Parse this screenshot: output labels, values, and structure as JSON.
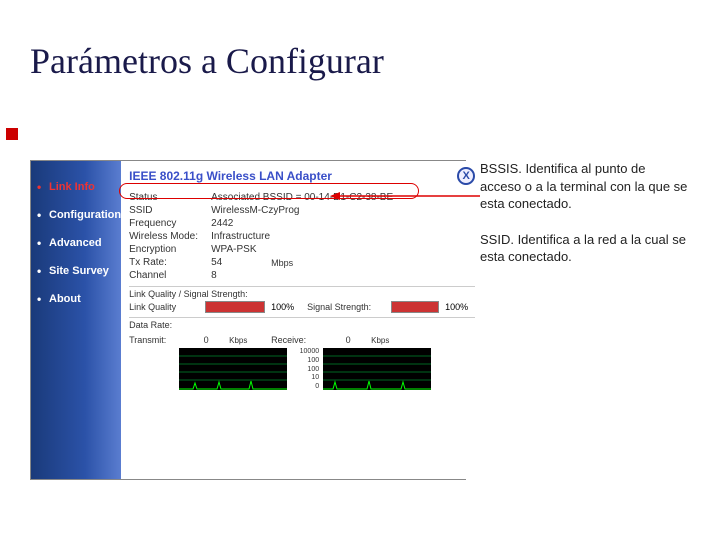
{
  "slide": {
    "title": "Parámetros a Configurar"
  },
  "sidebar": {
    "items": [
      {
        "label": "Link Info"
      },
      {
        "label": "Configuration"
      },
      {
        "label": "Advanced"
      },
      {
        "label": "Site Survey"
      },
      {
        "label": "About"
      }
    ]
  },
  "panel": {
    "title": "IEEE 802.11g Wireless LAN Adapter",
    "rows": {
      "status_lbl": "Status",
      "status_val": "Associated BSSID = 00-14-D1-C2-38-BE",
      "ssid_lbl": "SSID",
      "ssid_val": "WirelessM-CzyProg",
      "freq_lbl": "Frequency",
      "freq_val": "2442",
      "mode_lbl": "Wireless Mode:",
      "mode_val": "Infrastructure",
      "enc_lbl": "Encryption",
      "enc_val": "WPA-PSK",
      "txrate_lbl": "Tx Rate:",
      "txrate_val": "54",
      "txrate_unit": "Mbps",
      "channel_lbl": "Channel",
      "channel_val": "8"
    },
    "quality_section": "Link Quality / Signal Strength:",
    "link_quality_lbl": "Link Quality",
    "link_quality_pct": "100%",
    "signal_lbl": "Signal Strength:",
    "signal_pct": "100%",
    "data_rate_section": "Data Rate:",
    "transmit_lbl": "Transmit:",
    "transmit_val": "0",
    "transmit_unit": "Kbps",
    "receive_lbl": "Receive:",
    "receive_val": "0",
    "receive_unit": "Kbps",
    "yscale": [
      "10000",
      "100",
      "100",
      "10",
      "0"
    ]
  },
  "annotations": {
    "bssis": "BSSIS. Identifica al punto de acceso o a la terminal con la que se esta conectado.",
    "ssid": "SSID. Identifica a la red a la cual se esta conectado."
  }
}
